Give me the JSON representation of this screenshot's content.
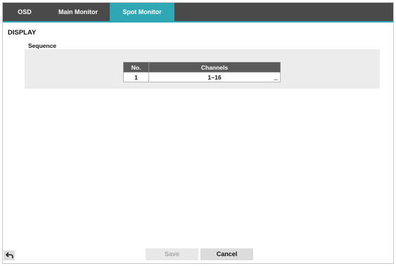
{
  "tabs": [
    {
      "label": "OSD",
      "active": false
    },
    {
      "label": "Main Monitor",
      "active": false
    },
    {
      "label": "Spot Monitor",
      "active": true
    }
  ],
  "section_title": "DISPLAY",
  "sequence": {
    "title": "Sequence",
    "columns": [
      "No.",
      "Channels"
    ],
    "rows": [
      {
        "no": "1",
        "channels": "1~16",
        "more": "..."
      }
    ]
  },
  "footer": {
    "back_icon": "back-arrow-icon",
    "save_label": "Save",
    "cancel_label": "Cancel"
  },
  "colors": {
    "accent": "#2fa7b4",
    "tabbar": "#4a4a4a"
  }
}
